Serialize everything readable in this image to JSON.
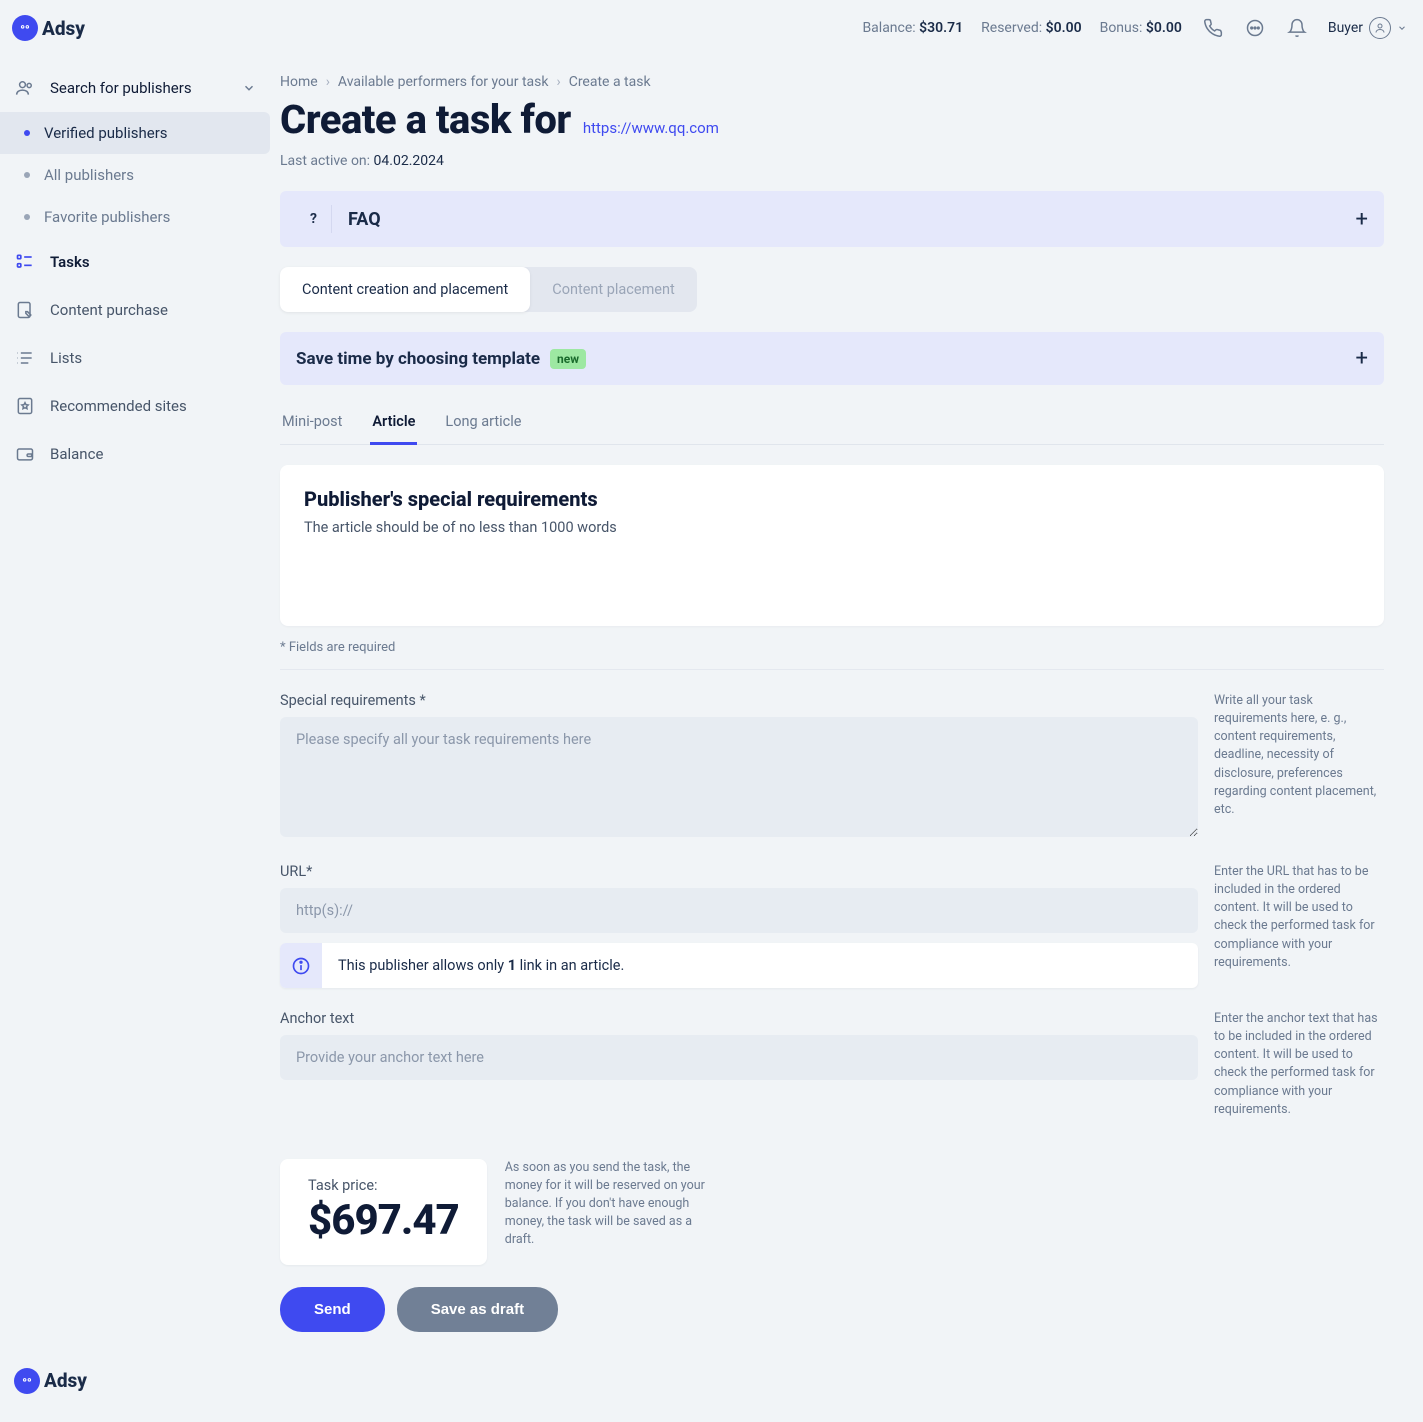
{
  "brand": "Adsy",
  "header": {
    "balance_label": "Balance:",
    "balance_value": "$30.71",
    "reserved_label": "Reserved:",
    "reserved_value": "$0.00",
    "bonus_label": "Bonus:",
    "bonus_value": "$0.00",
    "user_role": "Buyer"
  },
  "sidebar": {
    "search_label": "Search for publishers",
    "sub": {
      "verified": "Verified publishers",
      "all": "All publishers",
      "favorite": "Favorite publishers"
    },
    "tasks": "Tasks",
    "content_purchase": "Content purchase",
    "lists": "Lists",
    "recommended": "Recommended sites",
    "balance": "Balance"
  },
  "crumbs": {
    "home": "Home",
    "available": "Available performers for your task",
    "current": "Create a task"
  },
  "title": "Create a task for",
  "task_url": "https://www.qq.com",
  "last_active_label": "Last active on: ",
  "last_active_date": "04.02.2024",
  "faq_q": "?",
  "faq_title": "FAQ",
  "pill_creation": "Content creation and placement",
  "pill_placement": "Content placement",
  "template_title": "Save time by choosing template",
  "template_badge": "new",
  "type_tabs": {
    "mini": "Mini-post",
    "article": "Article",
    "long": "Long article"
  },
  "req_box": {
    "title": "Publisher's special requirements",
    "text": "The article should be of no less than 1000 words"
  },
  "required_hint": "* Fields are required",
  "fields": {
    "special": {
      "label": "Special requirements *",
      "placeholder": "Please specify all your task requirements here",
      "hint": "Write all your task requirements here, e. g., content requirements, deadline, necessity of disclosure, preferences regarding content placement, etc."
    },
    "url": {
      "label": "URL*",
      "placeholder": "http(s)://",
      "hint": "Enter the URL that has to be included in the ordered content. It will be used to check the performed task for compliance with your requirements.",
      "info_pre": "This publisher allows only ",
      "info_bold": "1",
      "info_post": " link in an article."
    },
    "anchor": {
      "label": "Anchor text",
      "placeholder": "Provide your anchor text here",
      "hint": "Enter the anchor text that has to be included in the ordered content. It will be used to check the performed task for compliance with your requirements."
    }
  },
  "price": {
    "label": "Task price:",
    "value": "$697.47",
    "hint": "As soon as you send the task, the money for it will be reserved on your balance. If you don't have enough money, the task will be saved as a draft."
  },
  "buttons": {
    "send": "Send",
    "draft": "Save as draft"
  }
}
